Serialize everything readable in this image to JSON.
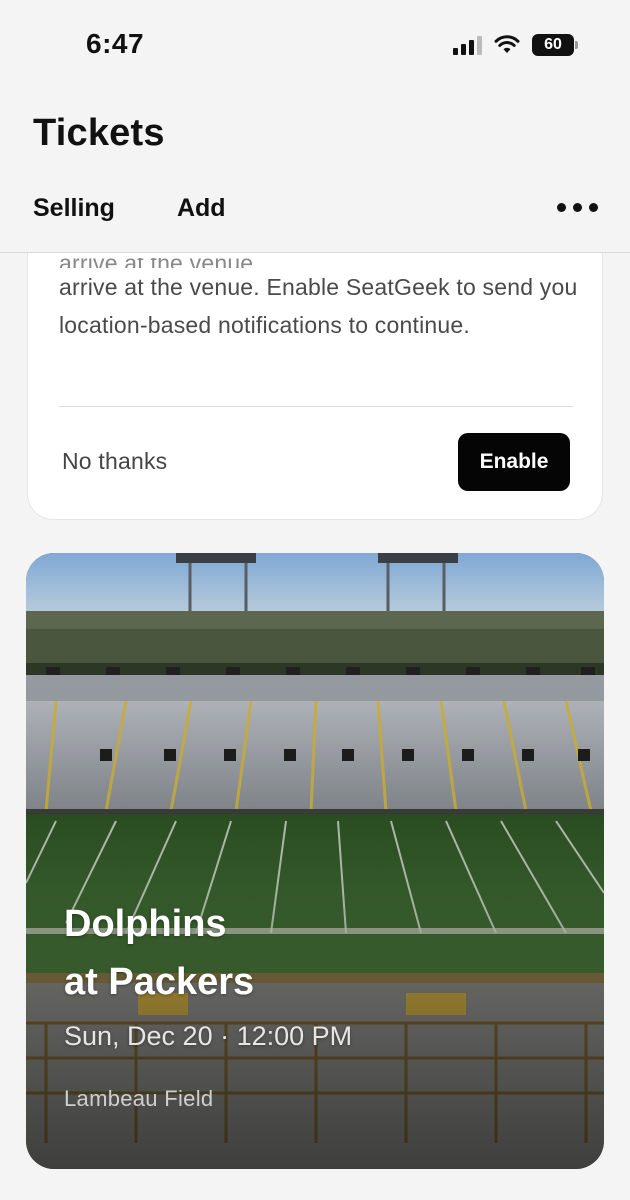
{
  "status_bar": {
    "time": "6:47",
    "battery": "60",
    "battery_level_percent": 60,
    "icons": [
      "cellular-signal-icon",
      "wifi-icon",
      "battery-icon"
    ]
  },
  "header": {
    "title": "Tickets",
    "tabs": [
      {
        "label": "Selling"
      },
      {
        "label": "Add"
      }
    ],
    "more_icon": "more-horizontal-icon"
  },
  "location_prompt": {
    "message_faded": "arrive at the venue",
    "message": "arrive at the venue. Enable SeatGeek to send you location-based notifications to continue.",
    "dismiss_label": "No thanks",
    "enable_label": "Enable"
  },
  "event": {
    "title_line1": "Dolphins",
    "title_line2": "at Packers",
    "date_time": "Sun, Dec 20 · 12:00 PM",
    "venue": "Lambeau Field"
  },
  "colors": {
    "background": "#f4f4f4",
    "card": "#ffffff",
    "primary_button": "#050505",
    "field_green": "#3e6b33",
    "stadium_green": "#4d5a40"
  }
}
